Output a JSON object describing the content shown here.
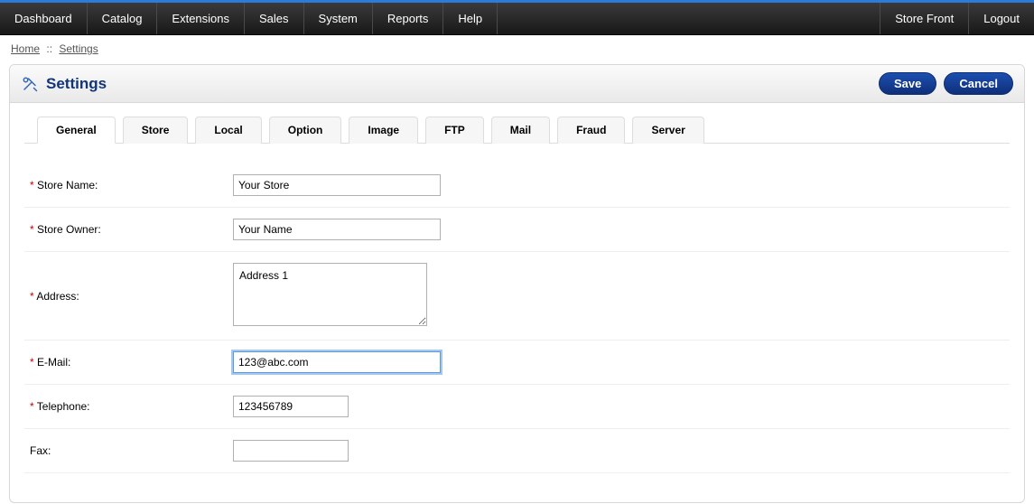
{
  "nav": {
    "left": [
      "Dashboard",
      "Catalog",
      "Extensions",
      "Sales",
      "System",
      "Reports",
      "Help"
    ],
    "right": [
      "Store Front",
      "Logout"
    ]
  },
  "breadcrumbs": {
    "home": "Home",
    "sep": "::",
    "current": "Settings"
  },
  "panel": {
    "title": "Settings",
    "save": "Save",
    "cancel": "Cancel"
  },
  "tabs": [
    "General",
    "Store",
    "Local",
    "Option",
    "Image",
    "FTP",
    "Mail",
    "Fraud",
    "Server"
  ],
  "form": {
    "store_name": {
      "label": "Store Name:",
      "value": "Your Store",
      "required": true
    },
    "store_owner": {
      "label": "Store Owner:",
      "value": "Your Name",
      "required": true
    },
    "address": {
      "label": "Address:",
      "value": "Address 1",
      "required": true
    },
    "email": {
      "label": "E-Mail:",
      "value": "123@abc.com",
      "required": true
    },
    "telephone": {
      "label": "Telephone:",
      "value": "123456789",
      "required": true
    },
    "fax": {
      "label": "Fax:",
      "value": "",
      "required": false
    }
  }
}
